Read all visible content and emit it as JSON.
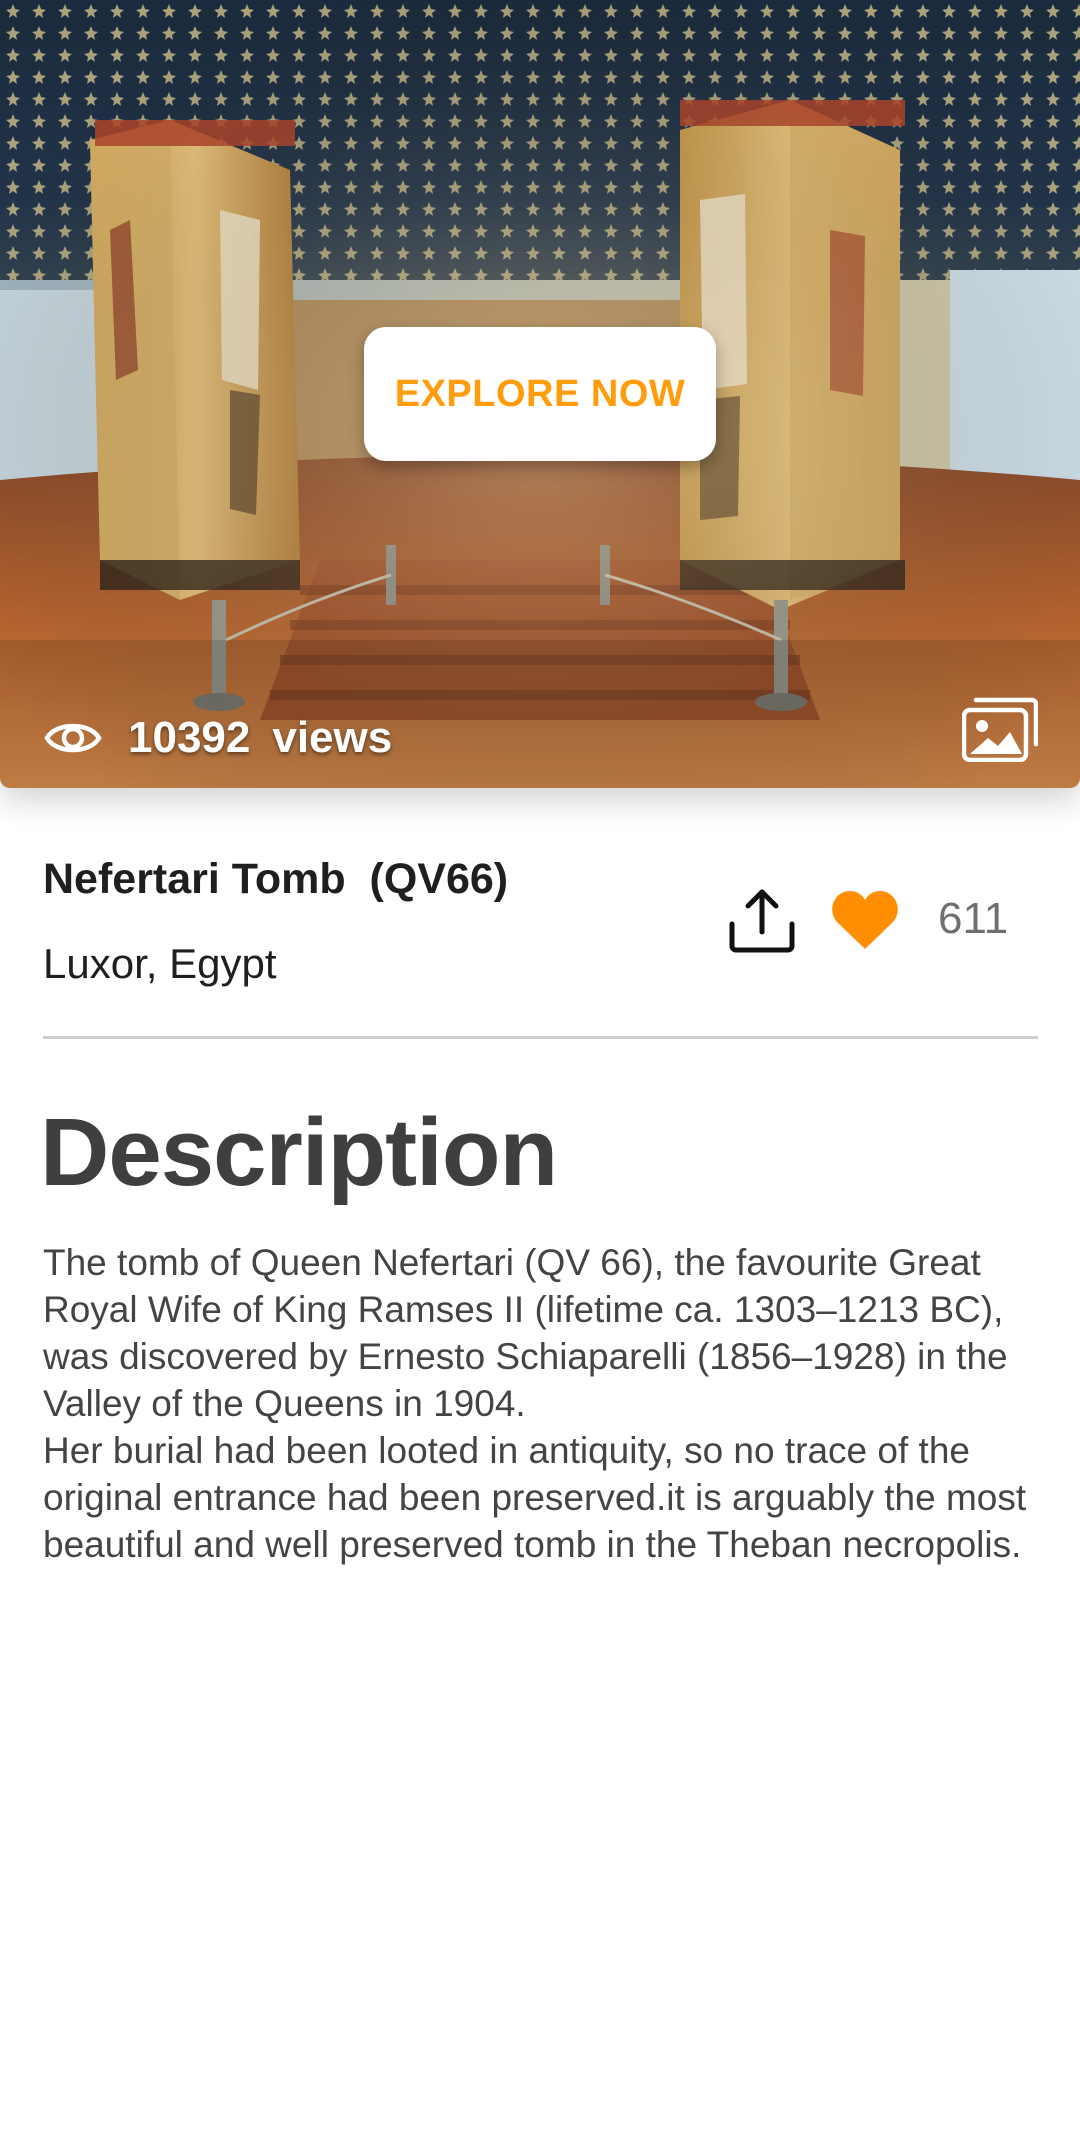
{
  "hero": {
    "explore_label": "EXPLORE NOW",
    "views_count": "10392",
    "views_label": "views",
    "icons": {
      "views": "eye-icon",
      "gallery": "gallery-icon"
    }
  },
  "place": {
    "title": "Nefertari Tomb  (QV66)",
    "location": "Luxor, Egypt",
    "likes": "611",
    "icons": {
      "share": "share-icon",
      "like": "heart-icon"
    }
  },
  "description": {
    "heading": "Description",
    "body": "The tomb of Queen Nefertari (QV 66), the favourite Great Royal Wife of King Ramses II (lifetime ca. 1303–1213 BC), was discovered by Ernesto Schiaparelli (1856–1928) in the Valley of the Queens in 1904.\nHer burial had been looted in antiquity, so no trace of the original entrance had been preserved.it is arguably the most beautiful and well preserved tomb in the Theban necropolis."
  },
  "colors": {
    "accent": "#ff9d0c",
    "heading": "#3f3f3f",
    "body_text": "#444444",
    "muted": "#6f6f6f",
    "divider": "#cfcfcf"
  }
}
